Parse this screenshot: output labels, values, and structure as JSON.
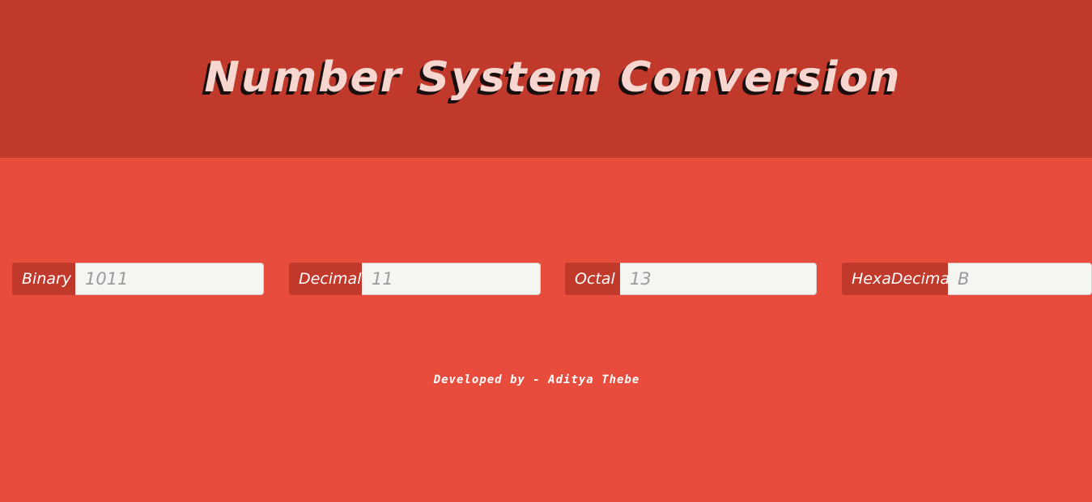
{
  "header": {
    "title": "Number System Conversion"
  },
  "converters": [
    {
      "label": "Binary",
      "value": "1011"
    },
    {
      "label": "Decimal",
      "value": "11"
    },
    {
      "label": "Octal",
      "value": "13"
    },
    {
      "label": "HexaDecimal",
      "value": "B"
    }
  ],
  "footer": {
    "credit": "Developed by - Aditya Thebe"
  },
  "colors": {
    "header_bg": "#c0392b",
    "page_bg": "#e74c3c",
    "label_bg": "#c0392b",
    "input_bg": "#f5f5f2",
    "title_text": "#f6d6cf"
  }
}
